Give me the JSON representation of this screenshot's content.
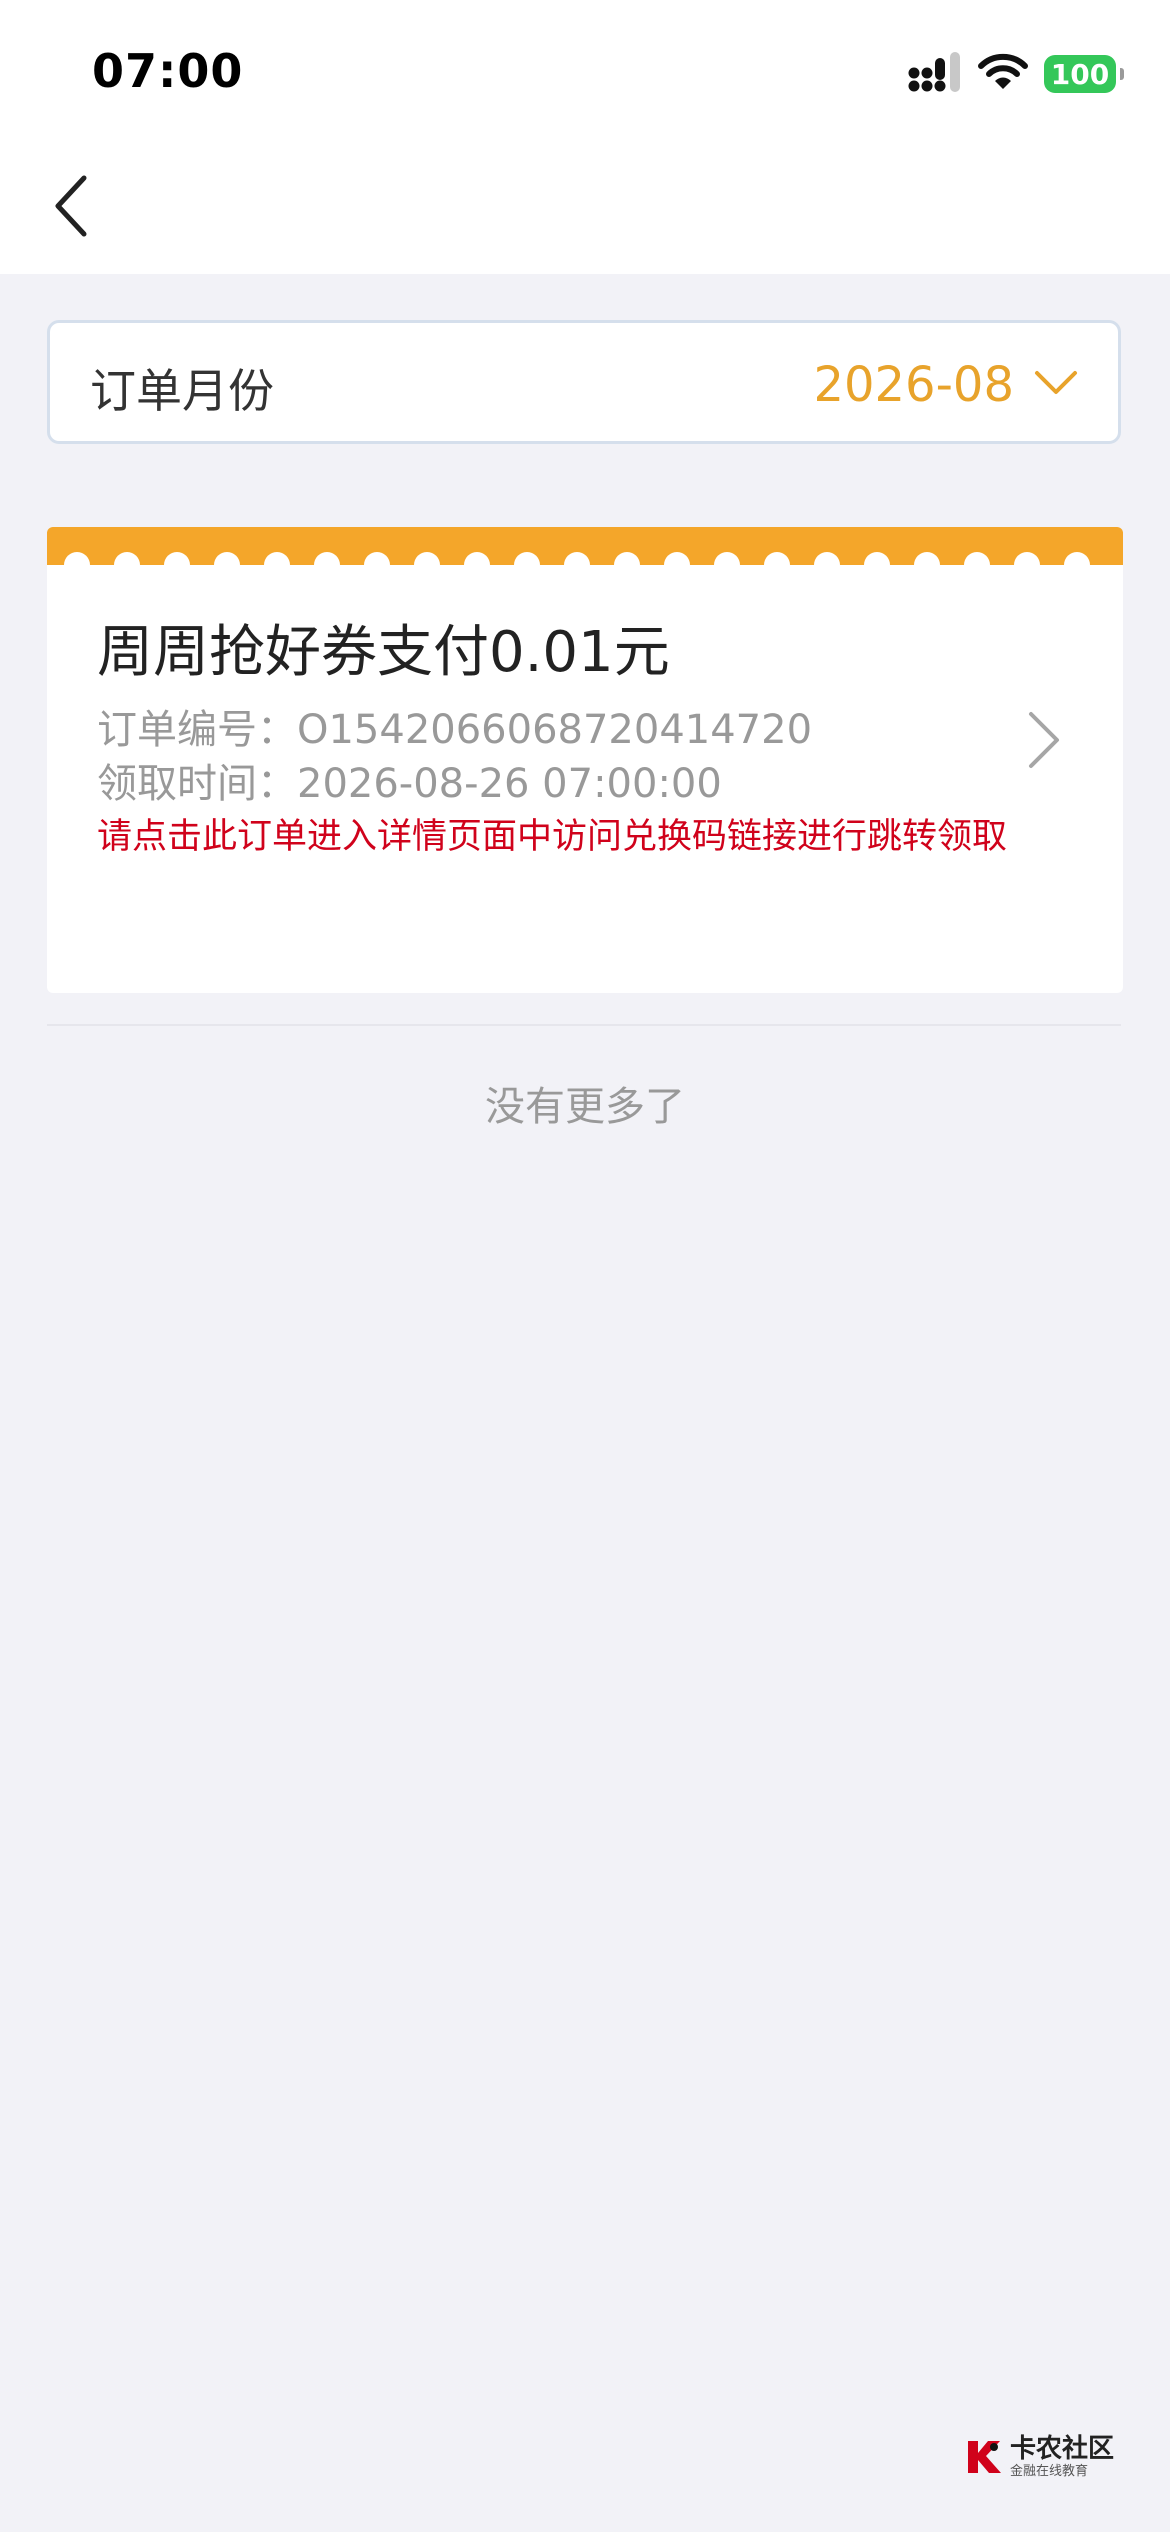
{
  "status_bar": {
    "time": "07:00",
    "battery": "100"
  },
  "filter": {
    "label": "订单月份",
    "value": "2026-08"
  },
  "order": {
    "title": "周周抢好券支付0.01元",
    "number_label": "订单编号：",
    "number": "O1542066068720414720",
    "time_label": "领取时间：",
    "time": "2026-08-26 07:00:00",
    "notice": "请点击此订单进入详情页面中访问兑换码链接进行跳转领取"
  },
  "list_end": "没有更多了",
  "watermark": {
    "name": "卡农社区",
    "subtitle": "金融在线教育"
  },
  "colors": {
    "accent": "#e8a32b",
    "ticket_band": "#f4a62a",
    "notice": "#d0021b",
    "battery": "#34c759"
  }
}
